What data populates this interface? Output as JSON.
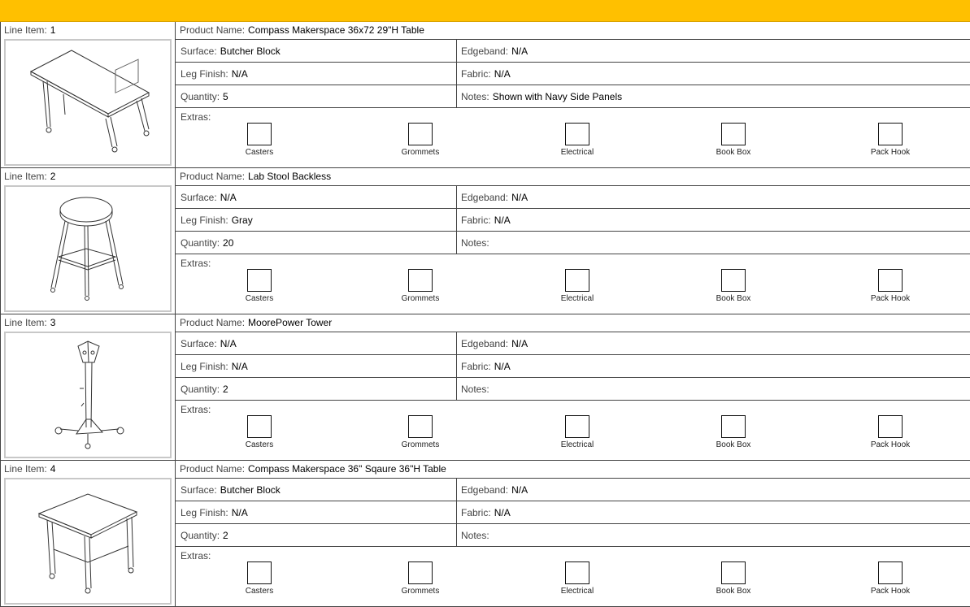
{
  "labels": {
    "line_item": "Line Item:",
    "product_name": "Product Name:",
    "surface": "Surface:",
    "edgeband": "Edgeband:",
    "leg_finish": "Leg Finish:",
    "fabric": "Fabric:",
    "quantity": "Quantity:",
    "notes": "Notes:",
    "extras": "Extras:"
  },
  "extras_options": [
    "Casters",
    "Grommets",
    "Electrical",
    "Book Box",
    "Pack Hook"
  ],
  "items": [
    {
      "number": "1",
      "product_name": "Compass Makerspace 36x72 29\"H Table",
      "surface": "Butcher Block",
      "edgeband": "N/A",
      "leg_finish": "N/A",
      "fabric": "N/A",
      "quantity": "5",
      "notes": "Shown with Navy Side Panels",
      "image_icon": "rectangular-table-drawing"
    },
    {
      "number": "2",
      "product_name": "Lab Stool Backless",
      "surface": "N/A",
      "edgeband": "N/A",
      "leg_finish": "Gray",
      "fabric": "N/A",
      "quantity": "20",
      "notes": "",
      "image_icon": "stool-drawing"
    },
    {
      "number": "3",
      "product_name": "MoorePower Tower",
      "surface": "N/A",
      "edgeband": "N/A",
      "leg_finish": "N/A",
      "fabric": "N/A",
      "quantity": "2",
      "notes": "",
      "image_icon": "power-tower-drawing"
    },
    {
      "number": "4",
      "product_name": "Compass Makerspace 36\" Sqaure 36\"H Table",
      "surface": "Butcher Block",
      "edgeband": "N/A",
      "leg_finish": "N/A",
      "fabric": "N/A",
      "quantity": "2",
      "notes": "",
      "image_icon": "square-table-drawing"
    }
  ],
  "colors": {
    "header_bar": "#ffc000",
    "border": "#444444",
    "thumb_border": "#c8c8c8"
  }
}
